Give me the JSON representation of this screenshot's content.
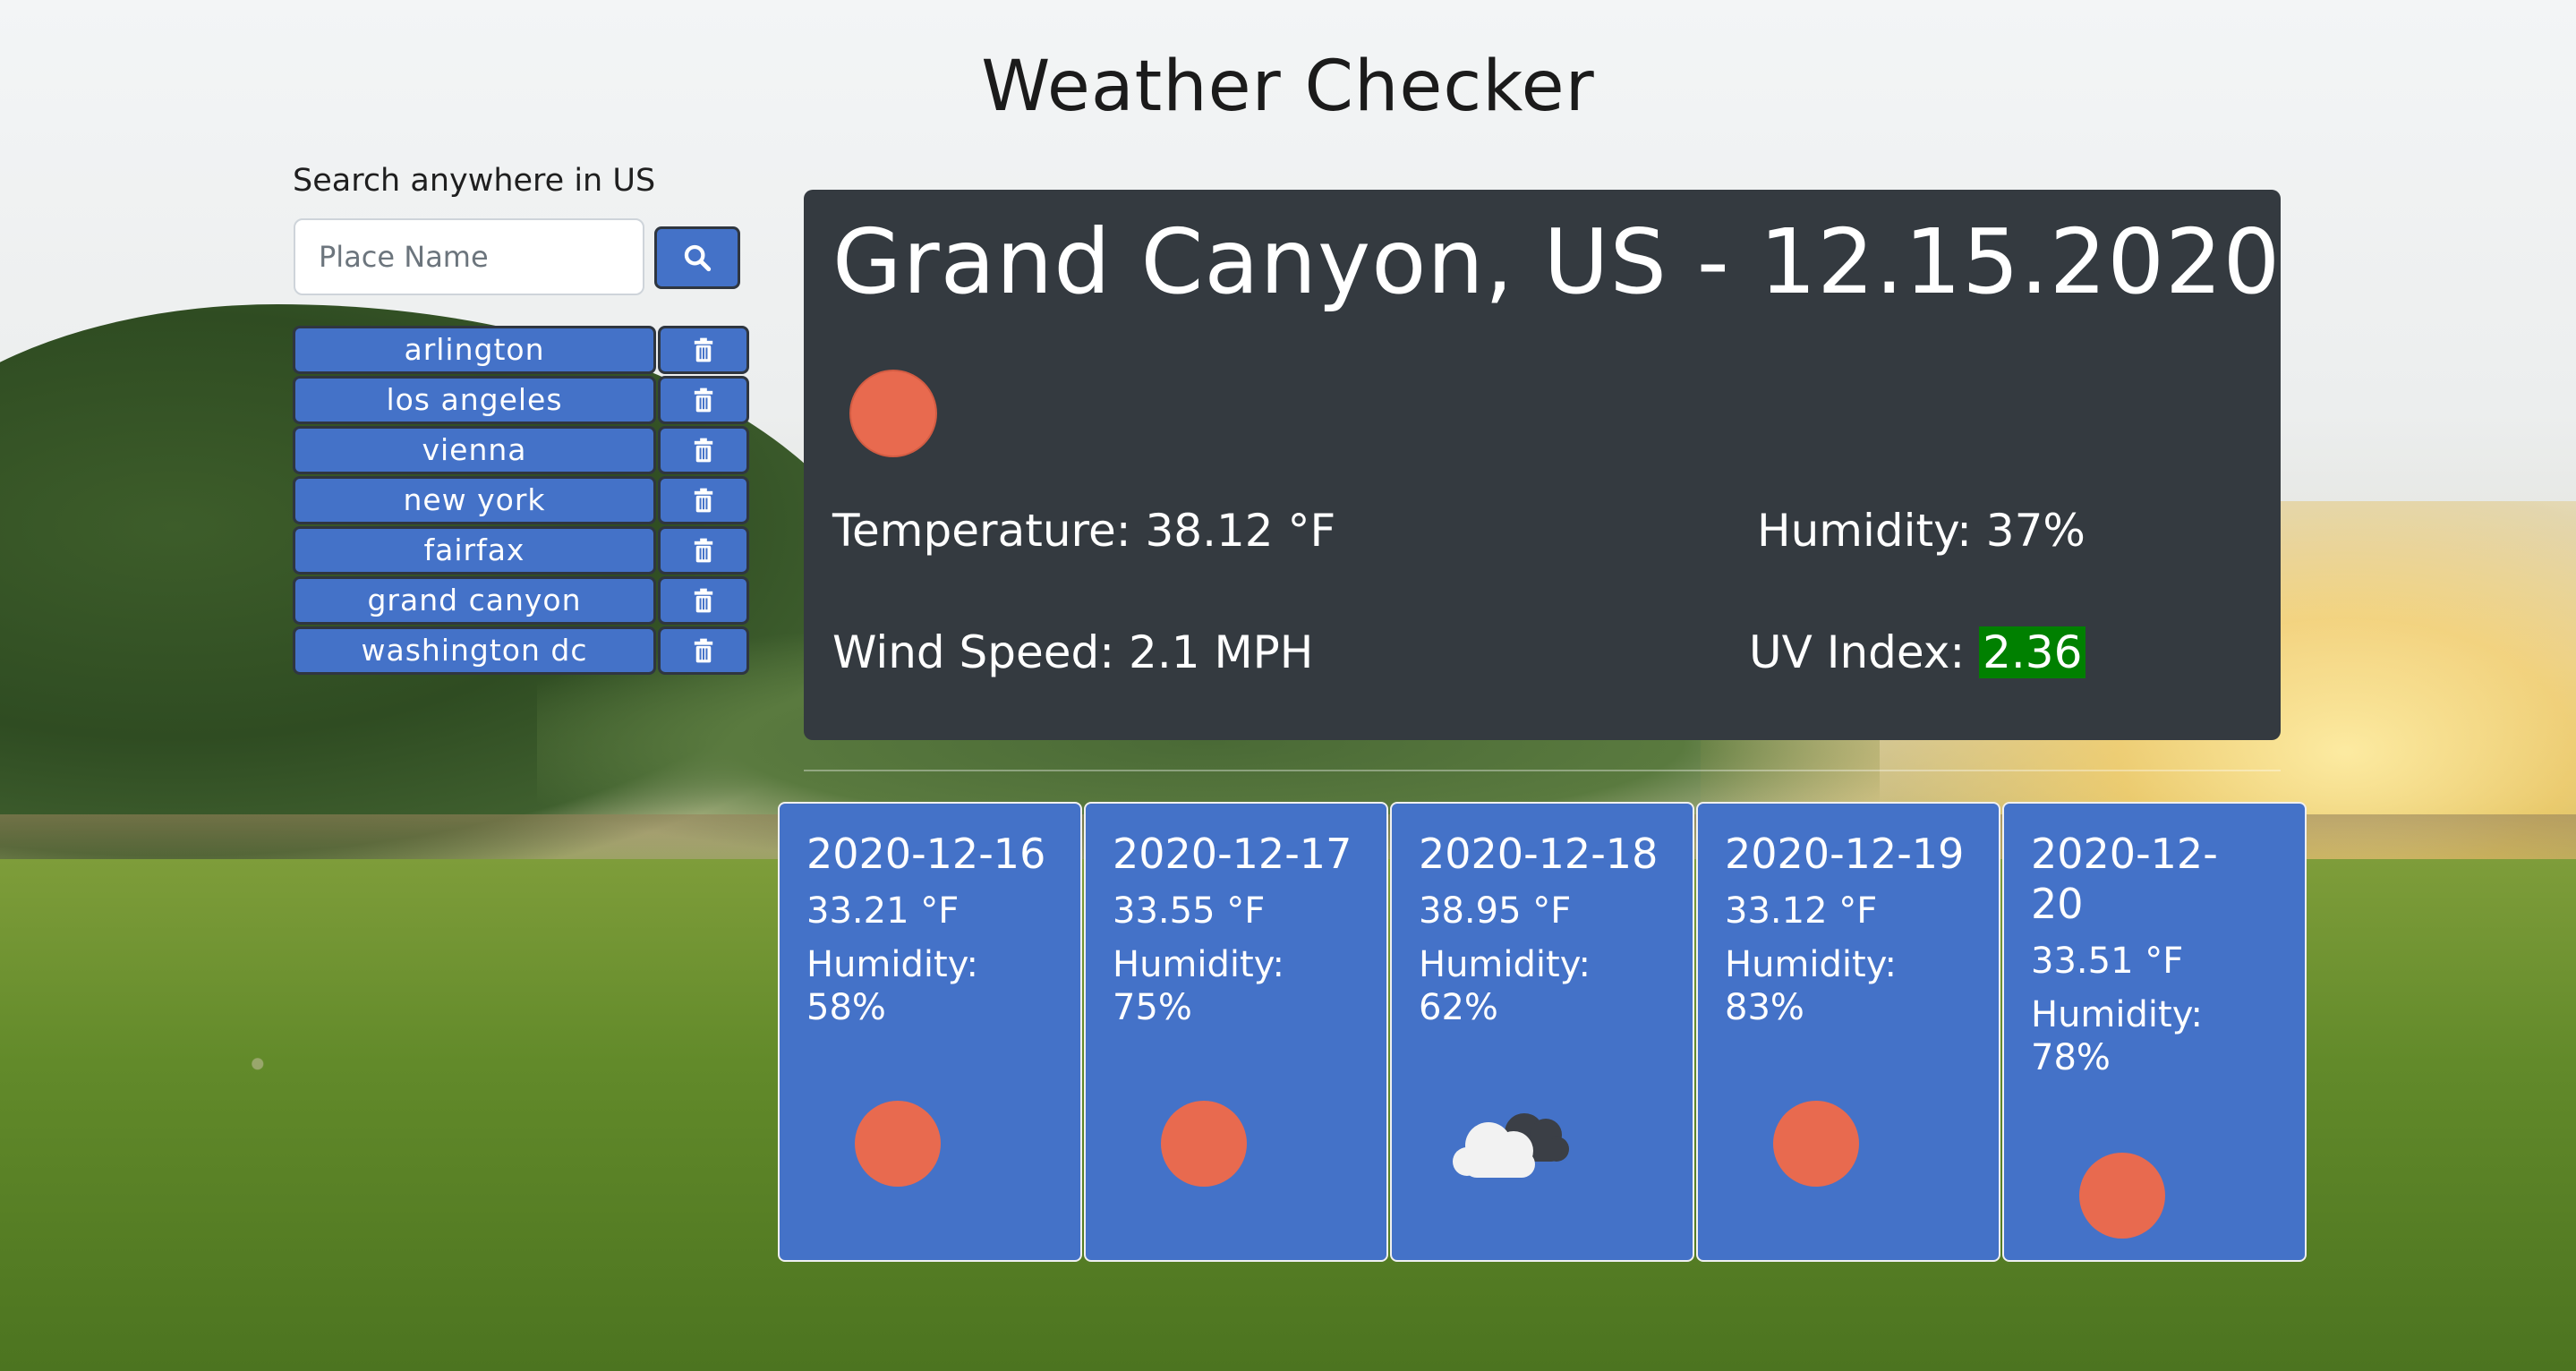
{
  "app": {
    "title": "Weather Checker"
  },
  "search": {
    "label": "Search anywhere in US",
    "placeholder": "Place Name",
    "button_icon": "search-icon"
  },
  "saved_cities": [
    {
      "label": "arlington"
    },
    {
      "label": "los angeles"
    },
    {
      "label": "vienna"
    },
    {
      "label": "new york"
    },
    {
      "label": "fairfax"
    },
    {
      "label": "grand canyon"
    },
    {
      "label": "washington dc"
    }
  ],
  "current": {
    "heading": "Grand Canyon, US - 12.15.2020",
    "icon": "sun-icon",
    "temperature": "Temperature: 38.12 °F",
    "humidity": "Humidity: 37%",
    "wind_speed": "Wind Speed: 2.1 MPH",
    "uv_label": "UV Index: ",
    "uv_value": "2.36",
    "uv_color": "#008000"
  },
  "forecast": [
    {
      "date": "2020-12-16",
      "temp": "33.21 °F",
      "humidity": "Humidity: 58%",
      "icon": "sun-icon"
    },
    {
      "date": "2020-12-17",
      "temp": "33.55 °F",
      "humidity": "Humidity: 75%",
      "icon": "sun-icon"
    },
    {
      "date": "2020-12-18",
      "temp": "38.95 °F",
      "humidity": "Humidity: 62%",
      "icon": "cloud-icon"
    },
    {
      "date": "2020-12-19",
      "temp": "33.12 °F",
      "humidity": "Humidity: 83%",
      "icon": "sun-icon"
    },
    {
      "date": "2020-12-20",
      "temp": "33.51 °F",
      "humidity": "Humidity: 78%",
      "icon": "sun-icon"
    }
  ],
  "colors": {
    "accent": "#4472c8",
    "panel": "#343a40",
    "sun": "#e86a4f"
  }
}
